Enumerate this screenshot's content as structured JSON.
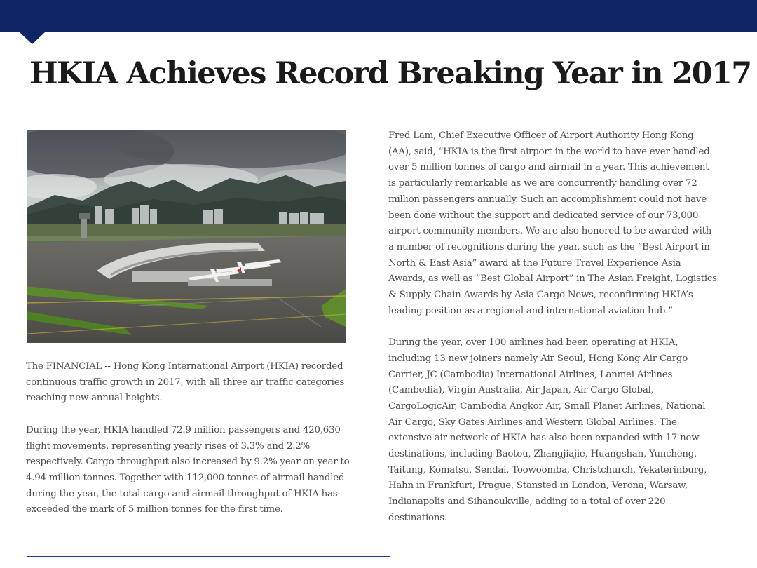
{
  "header": {
    "bar_color": "#0f2565"
  },
  "article": {
    "title": "HKIA Achieves Record Breaking Year in 2017",
    "photo_icon": "airport-aerial-photo",
    "left_paragraphs": [
      "The FINANCIAL -- Hong Kong International Airport (HKIA) recorded continuous traffic growth in 2017, with all three air traffic categories reaching new annual heights.",
      "During the year, HKIA handled 72.9 million passengers and 420,630 flight movements, representing yearly rises of 3.3% and 2.2% respectively. Cargo throughput also increased by 9.2% year on year to 4.94 million tonnes. Together with 112,000 tonnes of airmail handled during the year, the total cargo and airmail throughput of HKIA has exceeded the mark of 5 million tonnes for the first time."
    ],
    "right_paragraphs": [
      "Fred Lam, Chief Executive Officer of Airport Authority Hong Kong (AA), said, “HKIA is the first airport in the world to have ever handled over 5 million tonnes of cargo and airmail in a year. This achievement is particularly remarkable as we are concurrently handling over 72 million passengers annually. Such an accomplishment could not have been done without the support and dedicated service of our 73,000 airport community members. We are also honored to be awarded with a number of recognitions during the year, such as the “Best Airport in North & East Asia” award at the Future Travel Experience Asia Awards, as well as “Best Global Airport” in The Asian Freight, Logistics & Supply Chain Awards by Asia Cargo News, reconfirming HKIA’s leading position as a regional and international aviation hub.”",
      "During the year, over 100 airlines had been operating at HKIA, including 13 new joiners namely Air Seoul, Hong Kong Air Cargo Carrier, JC (Cambodia) International Airlines, Lanmei Airlines (Cambodia), Virgin Australia, Air Japan, Air Cargo Global, CargoLogicAir, Cambodia Angkor Air, Small Planet Airlines, National Air Cargo, Sky Gates Airlines and Western Global Airlines. The extensive air network of HKIA has also been expanded with 17 new destinations, including Baotou, Zhangjiajie, Huangshan, Yuncheng, Taitung, Komatsu, Sendai, Toowoomba, Christchurch, Yekaterinburg, Hahn in Frankfurt, Prague, Stansted in London, Verona, Warsaw, Indianapolis and Sihanoukville, adding to a total of over 220 destinations."
    ]
  }
}
